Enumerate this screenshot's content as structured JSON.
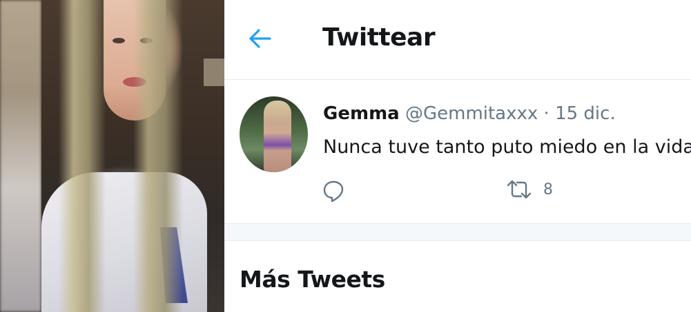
{
  "header": {
    "title": "Twittear",
    "back_icon": "arrow-left-icon"
  },
  "tweet": {
    "author_name": "Gemma",
    "author_meta": "@Gemmitaxxx · 15 dic.",
    "text": "Nunca tuve tanto puto miedo en la vida",
    "reply_icon": "reply-icon",
    "retweet_icon": "retweet-icon",
    "retweet_count": "8"
  },
  "more": {
    "title": "Más Tweets"
  },
  "colors": {
    "accent": "#1da1f2",
    "text_primary": "#14171a",
    "text_secondary": "#657786",
    "divider": "#e6ecf0",
    "separator_bg": "#f5f8fa"
  }
}
